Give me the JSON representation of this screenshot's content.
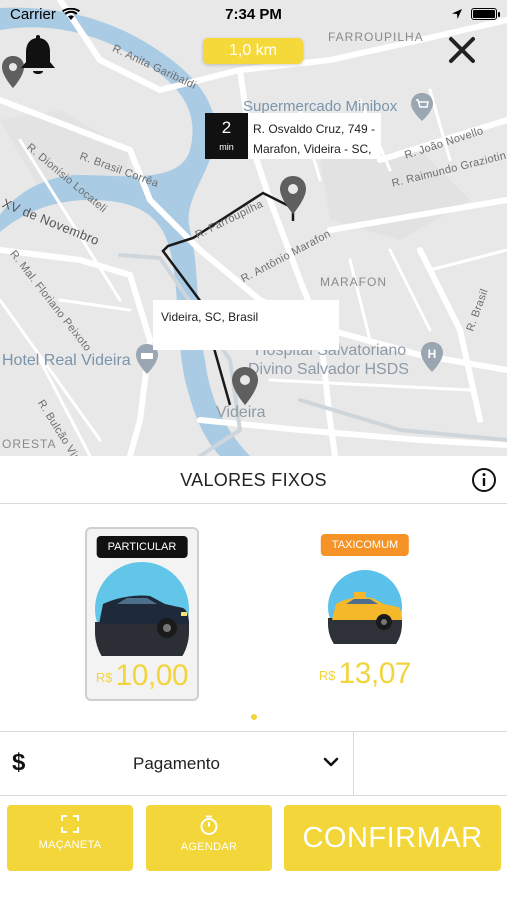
{
  "status_bar": {
    "carrier": "Carrier",
    "time": "7:34 PM"
  },
  "map": {
    "distance": "1,0 km",
    "eta": {
      "value": "2",
      "unit": "min"
    },
    "origin_address": "R. Osvaldo Cruz, 749 - Marafon, Videira - SC,",
    "destination_address": "Videira, SC, Brasil",
    "labels": {
      "farroupilha_top": "FARROUPILHA",
      "anita": "R. Anita Garibaldi",
      "supermercado": "Supermercado Minibox",
      "dionisio": "R. Dionísio Locateli",
      "brasil_correa": "R. Brasil Corrêa",
      "joao_novello": "R. João Novello",
      "raimundo": "R. Raimundo Graziotin",
      "xv": "XV de Novembro",
      "farroupilha_rua": "R. Farroupilha",
      "antonio_marafon": "R. Antônio Marafon",
      "mal_floriano": "R. Mal. Floriano Peixoto",
      "marafon": "MARAFON",
      "hospital1": "Hospital Salvatoriano",
      "hospital2": "Divino Salvador HSDS",
      "hotel": "Hotel Real Videira",
      "videira": "Videira",
      "bulcao": "R. Bulcão Vian",
      "oresta": "ORESTA",
      "r_brasil": "R. Brasil"
    }
  },
  "header": {
    "title": "VALORES FIXOS"
  },
  "options": [
    {
      "badge": "PARTICULAR",
      "currency": "R$",
      "price": "10,00",
      "selected": true
    },
    {
      "badge": "TAXICOMUM",
      "currency": "R$",
      "price": "13,07",
      "selected": false
    }
  ],
  "payment": {
    "label": "Pagamento",
    "icon": "$"
  },
  "actions": {
    "macaneta": "MAÇANETA",
    "agendar": "AGENDAR",
    "confirmar": "CONFIRMAR"
  },
  "colors": {
    "accent_yellow": "#F2D63A",
    "badge_orange": "#F59326",
    "river": "#AACBE4"
  }
}
